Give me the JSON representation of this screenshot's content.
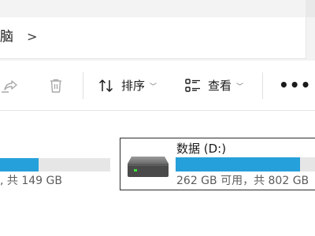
{
  "breadcrumb": {
    "partial_text": "脑",
    "separator": ">"
  },
  "toolbar": {
    "share_icon": "share-icon",
    "delete_icon": "trash-icon",
    "sort_label": "排序",
    "view_label": "查看",
    "more_label": "•••"
  },
  "drives": {
    "left_partial": {
      "caption": ", 共 149 GB",
      "usage_fraction": 0.35
    },
    "selected": {
      "name": "数据 (D:)",
      "caption": "262 GB 可用，共 802 GB",
      "usage_fraction": 0.89
    }
  },
  "colors": {
    "accent": "#26a0da",
    "bar_track": "#e6e6e6",
    "chrome_bg": "#f3f3f3"
  }
}
